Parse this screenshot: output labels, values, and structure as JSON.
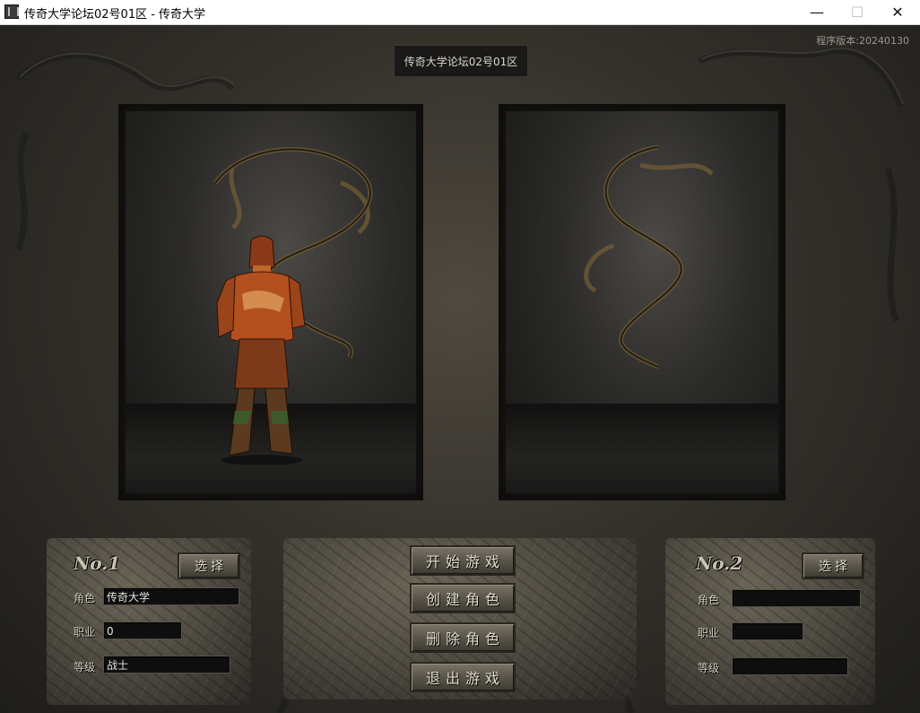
{
  "window": {
    "title": "传奇大学论坛02号01区 - 传奇大学",
    "minimize_glyph": "—",
    "maximize_glyph": "☐",
    "close_glyph": "✕"
  },
  "header": {
    "server_name": "传奇大学论坛02号01区",
    "version_text": "程序版本:20240130"
  },
  "slot1": {
    "title": "No.1",
    "select_label": "选择",
    "fields": [
      {
        "label": "角色",
        "value": "传奇大学"
      },
      {
        "label": "职业",
        "value": "0"
      },
      {
        "label": "等级",
        "value": "战士"
      }
    ]
  },
  "slot2": {
    "title": "No.2",
    "select_label": "选择",
    "fields": [
      {
        "label": "角色",
        "value": ""
      },
      {
        "label": "职业",
        "value": ""
      },
      {
        "label": "等级",
        "value": ""
      }
    ]
  },
  "menu": {
    "start": "开始游戏",
    "create": "创建角色",
    "delete": "删除角色",
    "exit": "退出游戏"
  },
  "icons": {
    "app": "app-icon",
    "character": "warrior-character-icon",
    "dragon": "dragon-carving-icon"
  }
}
